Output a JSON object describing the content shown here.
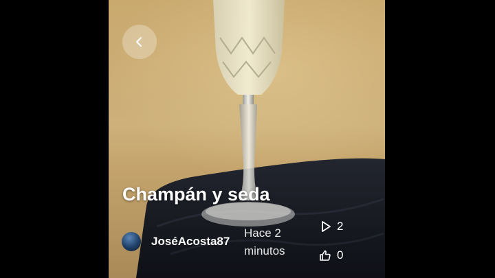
{
  "post": {
    "title": "Champán y seda",
    "author": "JoséAcosta87",
    "time": "Hace 2 minutos",
    "plays": "2",
    "likes": "0"
  },
  "icons": {
    "back": "chevron-left-icon",
    "plays": "play-outline-icon",
    "likes": "thumbs-up-outline-icon"
  },
  "colors": {
    "background": "#000000",
    "wall": "#c9a96e",
    "cloth": "#1a1d26"
  }
}
